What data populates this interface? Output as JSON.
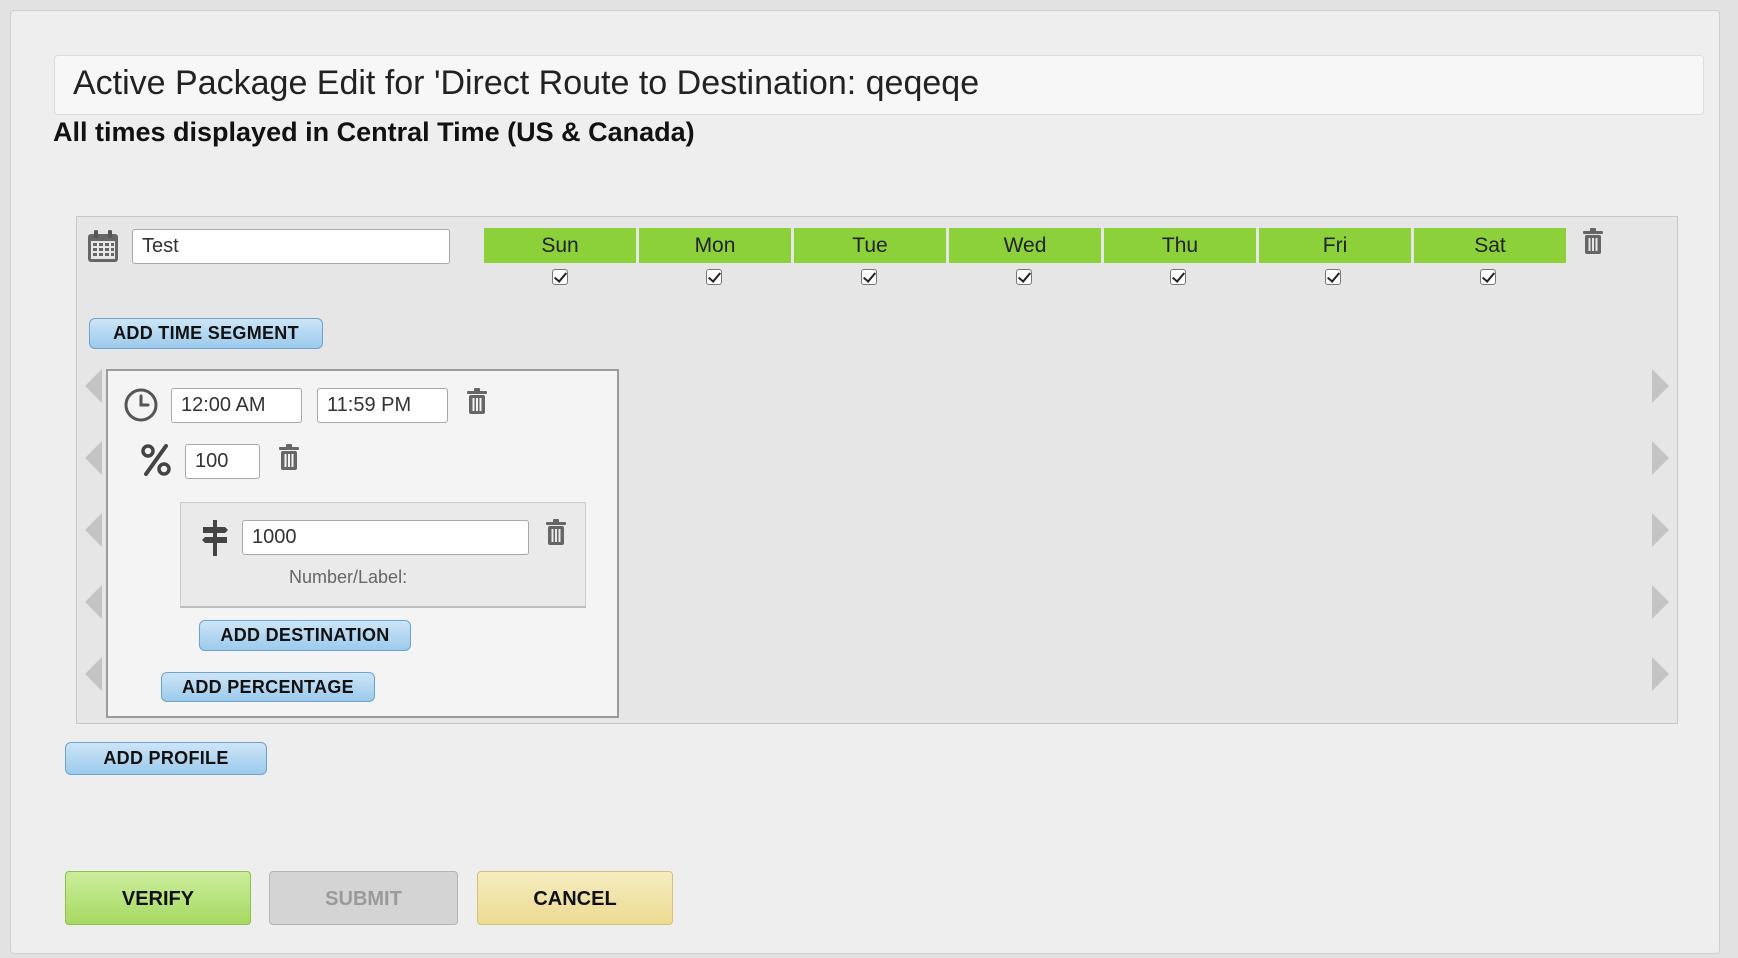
{
  "header": {
    "title": "Active Package Edit for 'Direct Route to Destination: qeqeqe",
    "timezone_note": "All times displayed in Central Time (US & Canada)"
  },
  "profile": {
    "name_value": "Test",
    "days": [
      {
        "label": "Sun",
        "checked": true
      },
      {
        "label": "Mon",
        "checked": true
      },
      {
        "label": "Tue",
        "checked": true
      },
      {
        "label": "Wed",
        "checked": true
      },
      {
        "label": "Thu",
        "checked": true
      },
      {
        "label": "Fri",
        "checked": true
      },
      {
        "label": "Sat",
        "checked": true
      }
    ],
    "add_time_segment_label": "ADD TIME SEGMENT",
    "segment": {
      "start_time": "12:00 AM",
      "end_time": "11:59 PM",
      "percentage": "100",
      "destination": {
        "value": "1000",
        "caption": "Number/Label:"
      },
      "add_destination_label": "ADD DESTINATION",
      "add_percentage_label": "ADD PERCENTAGE"
    }
  },
  "add_profile_label": "ADD PROFILE",
  "actions": {
    "verify_label": "VERIFY",
    "submit_label": "SUBMIT",
    "cancel_label": "CANCEL"
  },
  "colors": {
    "day_header": "#8dd13a",
    "verify_button": "#b7e27b",
    "submit_button_disabled": "#d4d4d4",
    "cancel_button": "#f1e3a8",
    "secondary_button": "#acd3f0"
  },
  "icons": [
    "calendar-icon",
    "trash-icon",
    "clock-icon",
    "percent-icon",
    "signpost-icon",
    "arrow-left-icon",
    "arrow-right-icon"
  ]
}
